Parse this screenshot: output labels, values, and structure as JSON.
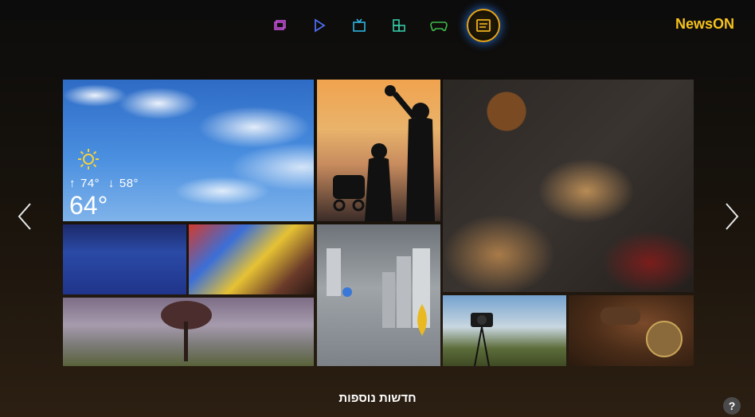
{
  "app": {
    "brand": "NewsON",
    "brand_color": "#f6c21c"
  },
  "topnav": {
    "items": [
      {
        "icon": "multiscreen-icon",
        "active": false
      },
      {
        "icon": "play-icon",
        "active": false
      },
      {
        "icon": "tv-icon",
        "active": false
      },
      {
        "icon": "apps-icon",
        "active": false
      },
      {
        "icon": "gamepad-icon",
        "active": false
      },
      {
        "icon": "news-icon",
        "active": true
      }
    ]
  },
  "weather": {
    "icon": "sun-icon",
    "high": "74°",
    "low": "58°",
    "current": "64°"
  },
  "tiles": [
    {
      "name": "tile-weather"
    },
    {
      "name": "tile-family-sunset"
    },
    {
      "name": "tile-nuts-spices"
    },
    {
      "name": "tile-diver"
    },
    {
      "name": "tile-child-painting"
    },
    {
      "name": "tile-city-map"
    },
    {
      "name": "tile-tree-field"
    },
    {
      "name": "tile-camera-tripod"
    },
    {
      "name": "tile-antique-compass"
    }
  ],
  "footer": {
    "more_news_label": "חדשות נוספות",
    "help_label": "?"
  }
}
